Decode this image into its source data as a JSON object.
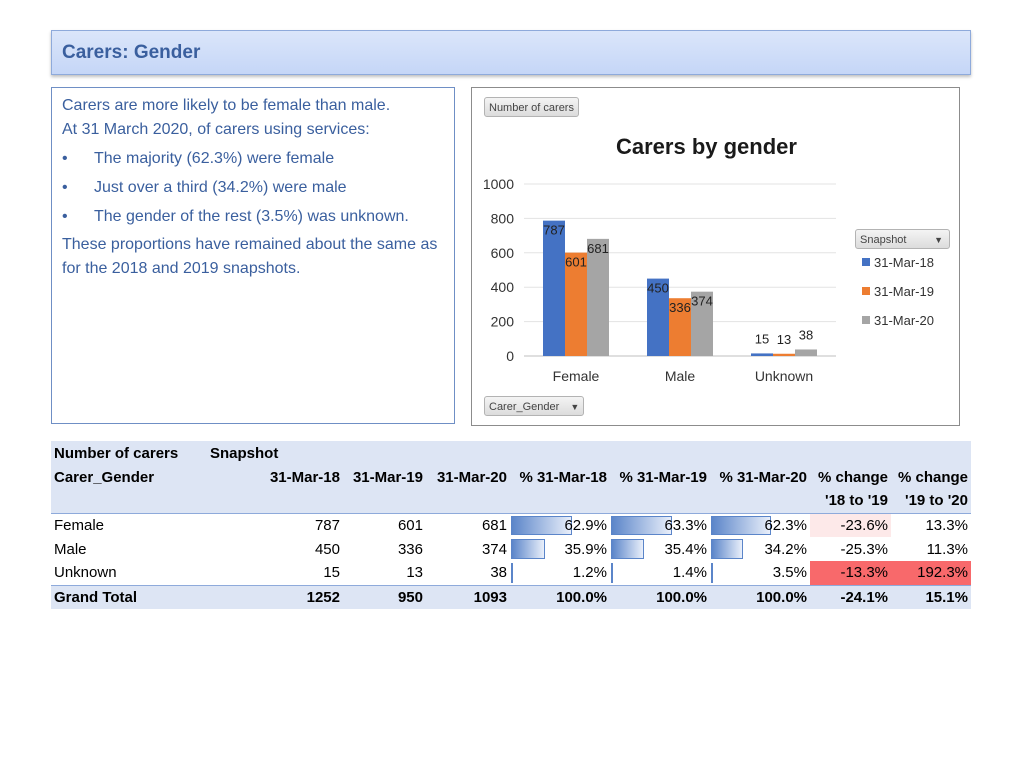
{
  "page": {
    "title": "Carers: Gender"
  },
  "text_panel": {
    "intro": "Carers are more likely to be female than male.",
    "lead": "At 31 March 2020, of carers using services:",
    "bullets": [
      "The majority (62.3%) were female",
      "Just over a third (34.2%) were male",
      "The gender of the rest (3.5%) was unknown."
    ],
    "closing": "These proportions have remained about the same as for the 2018 and 2019 snapshots."
  },
  "chart_controls": {
    "value_field": "Number of carers",
    "legend_field": "Snapshot",
    "axis_field": "Carer_Gender",
    "dropdown_icon": "triangle-down-icon"
  },
  "chart_data": {
    "type": "bar",
    "title": "Carers by gender",
    "categories": [
      "Female",
      "Male",
      "Unknown"
    ],
    "series": [
      {
        "name": "31-Mar-18",
        "values": [
          787,
          450,
          15
        ],
        "color": "#4472c4"
      },
      {
        "name": "31-Mar-19",
        "values": [
          601,
          336,
          13
        ],
        "color": "#ed7d31"
      },
      {
        "name": "31-Mar-20",
        "values": [
          681,
          374,
          38
        ],
        "color": "#a5a5a5"
      }
    ],
    "ylim": [
      0,
      1000
    ],
    "yticks": [
      0,
      200,
      400,
      600,
      800,
      1000
    ],
    "grid": true,
    "legend": "right",
    "data_labels": true
  },
  "table": {
    "corner_label": "Number of carers",
    "column_field": "Snapshot",
    "row_field": "Carer_Gender",
    "headers": [
      "31-Mar-18",
      "31-Mar-19",
      "31-Mar-20",
      "% 31-Mar-18",
      "% 31-Mar-19",
      "% 31-Mar-20",
      "% change",
      "% change"
    ],
    "headers_line2": [
      "",
      "",
      "",
      "",
      "",
      "",
      "'18 to '19",
      "'19 to '20"
    ],
    "rows": [
      {
        "label": "Female",
        "n18": "787",
        "n19": "601",
        "n20": "681",
        "p18": "62.9%",
        "p19": "63.3%",
        "p20": "62.3%",
        "c1": "-23.6%",
        "c2": "13.3%"
      },
      {
        "label": "Male",
        "n18": "450",
        "n19": "336",
        "n20": "374",
        "p18": "35.9%",
        "p19": "35.4%",
        "p20": "34.2%",
        "c1": "-25.3%",
        "c2": "11.3%"
      },
      {
        "label": "Unknown",
        "n18": "15",
        "n19": "13",
        "n20": "38",
        "p18": "1.2%",
        "p19": "1.4%",
        "p20": "3.5%",
        "c1": "-13.3%",
        "c2": "192.3%"
      }
    ],
    "total": {
      "label": "Grand Total",
      "n18": "1252",
      "n19": "950",
      "n20": "1093",
      "p18": "100.0%",
      "p19": "100.0%",
      "p20": "100.0%",
      "c1": "-24.1%",
      "c2": "15.1%"
    },
    "pct_fractions": [
      [
        0.629,
        0.633,
        0.623
      ],
      [
        0.359,
        0.354,
        0.342
      ],
      [
        0.012,
        0.014,
        0.035
      ]
    ],
    "change_colors": [
      [
        "#fde9e9",
        "#ffffff"
      ],
      [
        "#ffffff",
        "#ffffff"
      ],
      [
        "#f8696b",
        "#f8696b"
      ]
    ],
    "colors": {
      "header_bg": "#dde5f4",
      "title_text": "#3a5f9e",
      "databar": "#5b85c9"
    }
  }
}
